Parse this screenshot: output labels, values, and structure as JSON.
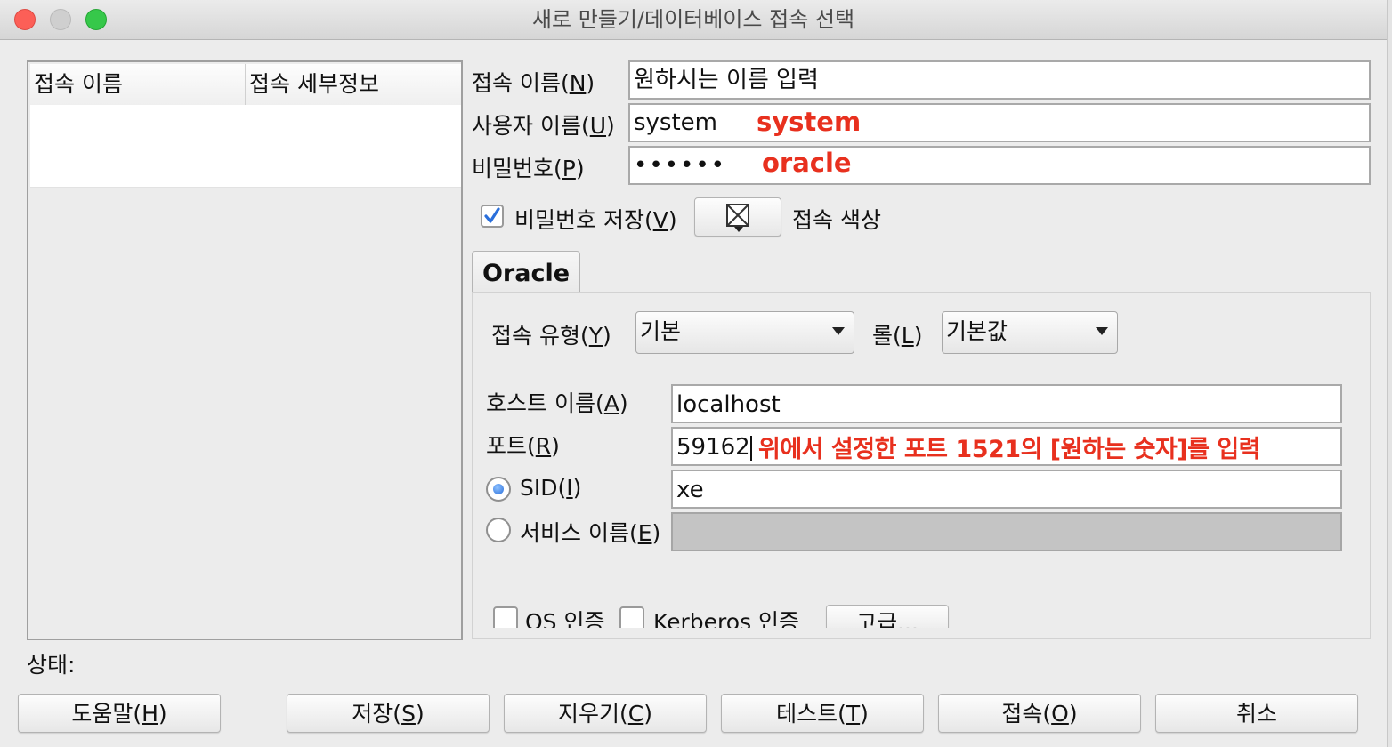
{
  "window": {
    "title": "새로 만들기/데이터베이스 접속 선택"
  },
  "connection_list": {
    "columns": [
      "접속 이름",
      "접속 세부정보"
    ]
  },
  "form": {
    "conn_name": {
      "label_text": "접속 이름(",
      "mnemonic": "N",
      "value": "원하시는 이름 입력"
    },
    "username": {
      "label_text": "사용자 이름(",
      "mnemonic": "U",
      "value": "system",
      "annotation": "system"
    },
    "password": {
      "label_text": "비밀번호(",
      "mnemonic": "P",
      "value": "••••••",
      "annotation": "oracle"
    },
    "save_password": {
      "label_text": "비밀번호 저장(",
      "mnemonic": "V",
      "checked": true
    },
    "conn_color": {
      "label": "접속 색상"
    }
  },
  "tab": {
    "label": "Oracle"
  },
  "oracle": {
    "conn_type": {
      "label_text": "접속 유형(",
      "mnemonic": "Y",
      "value": "기본"
    },
    "role": {
      "label_text": "롤(",
      "mnemonic": "L",
      "value": "기본값"
    },
    "host": {
      "label_text": "호스트 이름(",
      "mnemonic": "A",
      "value": "localhost"
    },
    "port": {
      "label_text": "포트(",
      "mnemonic": "R",
      "value": "59162",
      "annotation": "위에서 설정한 포트 1521의 [원하는 숫자]를 입력"
    },
    "sid": {
      "label_text": "SID(",
      "mnemonic": "I",
      "value": "xe",
      "selected": true
    },
    "service": {
      "label_text": "서비스 이름(",
      "mnemonic": "E",
      "value": ""
    },
    "os_auth": {
      "label": "OS 인증"
    },
    "kerberos_auth": {
      "label": "Kerberos 인증"
    },
    "advanced": {
      "label": "고급..."
    }
  },
  "status": {
    "label": "상태:"
  },
  "buttons": {
    "help": {
      "text": "도움말(",
      "mnemonic": "H"
    },
    "save": {
      "text": "저장(",
      "mnemonic": "S"
    },
    "clear": {
      "text": "지우기(",
      "mnemonic": "C"
    },
    "test": {
      "text": "테스트(",
      "mnemonic": "T"
    },
    "connect": {
      "text": "접속(",
      "mnemonic": "O"
    },
    "cancel": {
      "text": "취소"
    }
  },
  "colors": {
    "annotation": "#e8301e",
    "accent": "#2a6fdb"
  }
}
